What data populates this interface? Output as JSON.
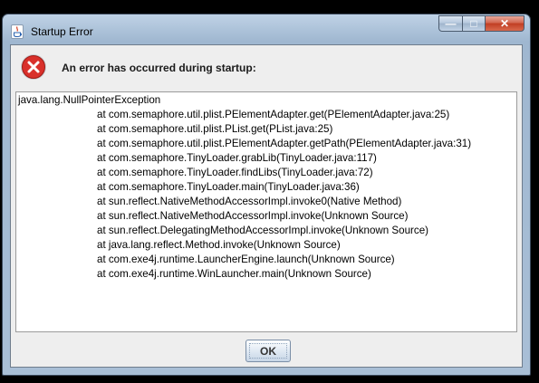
{
  "window": {
    "title": "Startup Error",
    "icon": "java-icon",
    "controls": {
      "minimize_glyph": "—",
      "maximize_glyph": "□",
      "close_glyph": "✕"
    }
  },
  "message": {
    "icon": "error-icon",
    "heading": "An error has occurred during startup:"
  },
  "trace": {
    "exception": "java.lang.NullPointerException",
    "frames": [
      "at com.semaphore.util.plist.PElementAdapter.get(PElementAdapter.java:25)",
      "at com.semaphore.util.plist.PList.get(PList.java:25)",
      "at com.semaphore.util.plist.PElementAdapter.getPath(PElementAdapter.java:31)",
      "at com.semaphore.TinyLoader.grabLib(TinyLoader.java:117)",
      "at com.semaphore.TinyLoader.findLibs(TinyLoader.java:72)",
      "at com.semaphore.TinyLoader.main(TinyLoader.java:36)",
      "at sun.reflect.NativeMethodAccessorImpl.invoke0(Native Method)",
      "at sun.reflect.NativeMethodAccessorImpl.invoke(Unknown Source)",
      "at sun.reflect.DelegatingMethodAccessorImpl.invoke(Unknown Source)",
      "at java.lang.reflect.Method.invoke(Unknown Source)",
      "at com.exe4j.runtime.LauncherEngine.launch(Unknown Source)",
      "at com.exe4j.runtime.WinLauncher.main(Unknown Source)"
    ]
  },
  "buttons": {
    "ok_label": "OK"
  },
  "colors": {
    "error_red": "#d9302b",
    "title_bar": "#a9bfd6",
    "close_button": "#c13d22"
  }
}
